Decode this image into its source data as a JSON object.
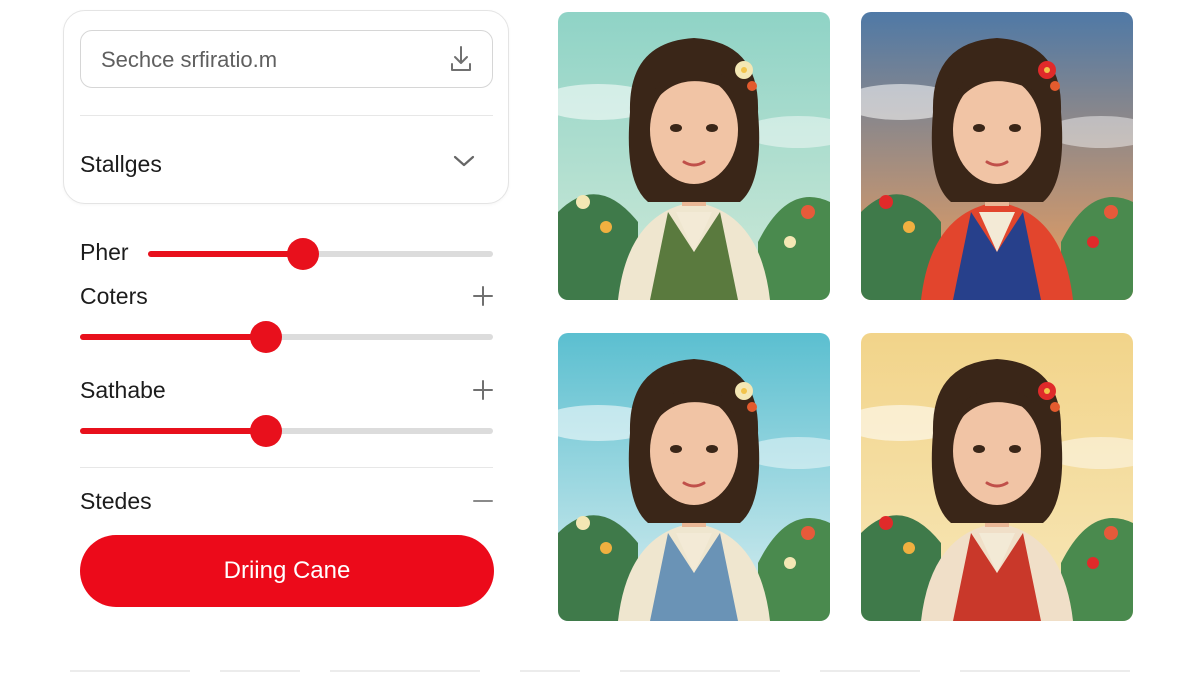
{
  "search": {
    "placeholder": "Sechce srfiratio.m",
    "icon": "download-icon"
  },
  "styles_section": {
    "label": "Stallges",
    "icon": "chevron-down-icon"
  },
  "adjustments": [
    {
      "label": "Pher",
      "value": 0.45
    },
    {
      "label": "Coters",
      "value": 0.45,
      "icon": "plus-icon"
    },
    {
      "label": "Sathabe",
      "value": 0.45,
      "icon": "plus-icon"
    }
  ],
  "steps_section": {
    "label": "Stedes",
    "icon": "minus-icon"
  },
  "primary_button": {
    "label": "Driing Cane"
  },
  "colors": {
    "accent": "#e8101c",
    "track": "#dcdcdc"
  },
  "gallery": [
    {
      "name": "portrait-teal",
      "sky": "#8fd3c6",
      "sky2": "#cfe9d8",
      "top": "#efe6cf",
      "vest": "#5a7a3e",
      "flower": "#f4e7b4"
    },
    {
      "name": "portrait-sunset",
      "sky": "#4f79a6",
      "sky2": "#f1a05c",
      "top": "#e2452d",
      "vest": "#27408b",
      "flower": "#e02a2a"
    },
    {
      "name": "portrait-blue",
      "sky": "#5bbfd0",
      "sky2": "#d9eef0",
      "top": "#efe6cf",
      "vest": "#6a93b6",
      "flower": "#f4e7b4"
    },
    {
      "name": "portrait-golden",
      "sky": "#f2d48a",
      "sky2": "#f7e7b8",
      "top": "#f0dfc8",
      "vest": "#c9382a",
      "flower": "#e02a2a"
    }
  ]
}
